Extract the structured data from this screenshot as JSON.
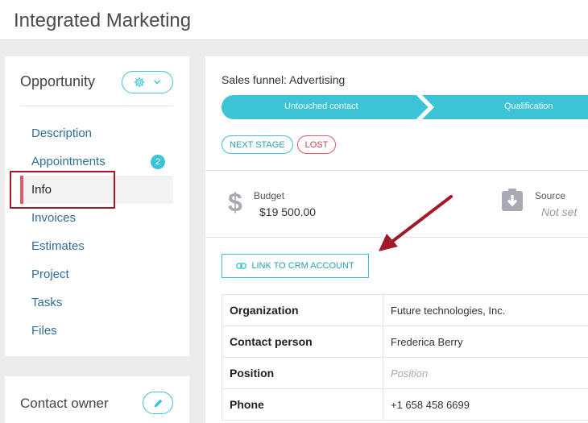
{
  "header": {
    "title": "Integrated Marketing"
  },
  "sidebar": {
    "title": "Opportunity",
    "items": [
      {
        "label": "Description"
      },
      {
        "label": "Appointments",
        "badge": "2"
      },
      {
        "label": "Info"
      },
      {
        "label": "Invoices"
      },
      {
        "label": "Estimates"
      },
      {
        "label": "Project"
      },
      {
        "label": "Tasks"
      },
      {
        "label": "Files"
      }
    ],
    "active_item": "Info"
  },
  "owner": {
    "title": "Contact owner"
  },
  "funnel": {
    "label": "Sales funnel: Advertising",
    "stages": [
      {
        "label": "Untouched contact"
      },
      {
        "label": "Qualification"
      }
    ],
    "next_stage_label": "NEXT STAGE",
    "lost_label": "LOST"
  },
  "metrics": {
    "budget": {
      "label": "Budget",
      "value": "$19 500.00",
      "icon": "dollar-icon"
    },
    "source": {
      "label": "Source",
      "value": "Not set",
      "icon": "download-icon"
    }
  },
  "link_button": {
    "label": "LINK TO CRM ACCOUNT"
  },
  "table": {
    "rows": [
      {
        "key": "Organization",
        "value": "Future technologies, Inc."
      },
      {
        "key": "Contact person",
        "value": "Frederica Berry"
      },
      {
        "key": "Position",
        "value": "Position"
      },
      {
        "key": "Phone",
        "value": "+1 658 458 6699"
      }
    ]
  },
  "colors": {
    "accent": "#3cc4d6",
    "danger": "#e05a6a",
    "annotation": "#a01a2a"
  }
}
